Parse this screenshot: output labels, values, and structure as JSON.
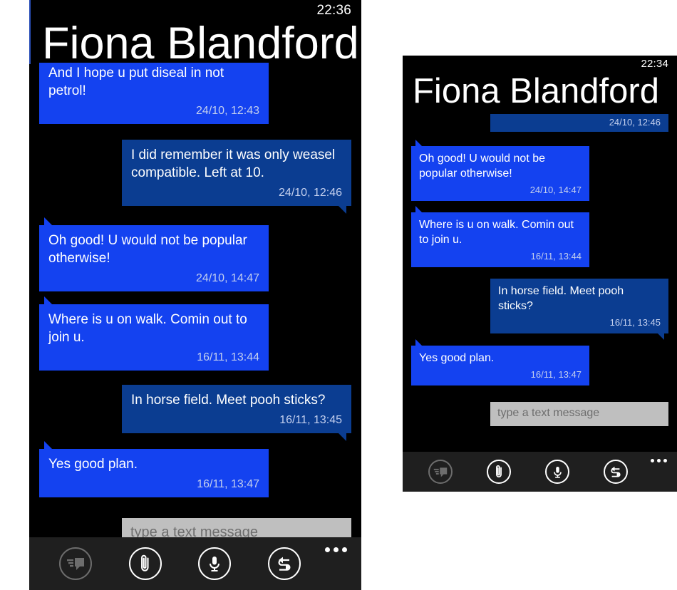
{
  "page": {
    "background": "#ffffff",
    "accent_incoming": "#1442f0",
    "accent_outgoing": "#0b3d91",
    "composer_background": "#bfbfbf",
    "appbar_background": "#1f1f1f"
  },
  "phones": [
    {
      "id": "left",
      "status": {
        "clock": "22:36"
      },
      "title": "Fiona Blandford",
      "messages": [
        {
          "direction": "incoming",
          "text": "And I hope u put diseal in not petrol!",
          "time": "24/10, 12:43",
          "clipped": true
        },
        {
          "direction": "outgoing",
          "text": "I did remember it was only weasel compatible. Left at 10.",
          "time": "24/10, 12:46",
          "clipped": false
        },
        {
          "direction": "incoming",
          "text": "Oh good! U would not be popular otherwise!",
          "time": "24/10, 14:47",
          "clipped": false
        },
        {
          "direction": "incoming",
          "text": "Where is u on walk. Comin out to join u.",
          "time": "16/11, 13:44",
          "clipped": false
        },
        {
          "direction": "outgoing",
          "text": "In horse field. Meet pooh sticks?",
          "time": "16/11, 13:45",
          "clipped": false
        },
        {
          "direction": "incoming",
          "text": "Yes good plan.",
          "time": "16/11, 13:47",
          "clipped": false
        }
      ],
      "composer": {
        "placeholder": "type a text message",
        "value": ""
      },
      "appbar": {
        "buttons": [
          {
            "icon": "chat-bubble-icon",
            "label": "messaging",
            "state": "disabled"
          },
          {
            "icon": "paperclip-icon",
            "label": "attach",
            "state": "enabled"
          },
          {
            "icon": "microphone-icon",
            "label": "voice",
            "state": "enabled"
          },
          {
            "icon": "switch-arrows-icon",
            "label": "switch",
            "state": "enabled"
          }
        ],
        "more_label": "more"
      }
    },
    {
      "id": "right",
      "status": {
        "clock": "22:34"
      },
      "title": "Fiona Blandford",
      "messages": [
        {
          "direction": "outgoing",
          "text": "",
          "time": "24/10, 12:46",
          "clipped": true
        },
        {
          "direction": "incoming",
          "text": "Oh good! U would not be popular otherwise!",
          "time": "24/10, 14:47",
          "clipped": false
        },
        {
          "direction": "incoming",
          "text": "Where is u on walk. Comin out to join u.",
          "time": "16/11, 13:44",
          "clipped": false
        },
        {
          "direction": "outgoing",
          "text": "In horse field. Meet pooh sticks?",
          "time": "16/11, 13:45",
          "clipped": false
        },
        {
          "direction": "incoming",
          "text": "Yes good plan.",
          "time": "16/11, 13:47",
          "clipped": false
        }
      ],
      "composer": {
        "placeholder": "type a text message",
        "value": ""
      },
      "appbar": {
        "buttons": [
          {
            "icon": "chat-bubble-icon",
            "label": "messaging",
            "state": "disabled"
          },
          {
            "icon": "paperclip-icon",
            "label": "attach",
            "state": "enabled"
          },
          {
            "icon": "microphone-icon",
            "label": "voice",
            "state": "enabled"
          },
          {
            "icon": "switch-arrows-icon",
            "label": "switch",
            "state": "enabled"
          }
        ],
        "more_label": "more"
      }
    }
  ]
}
